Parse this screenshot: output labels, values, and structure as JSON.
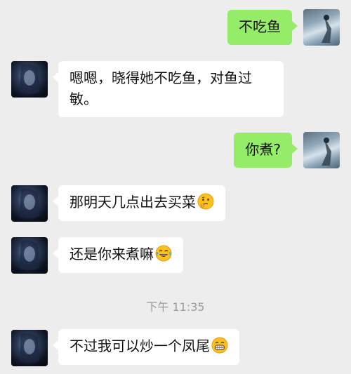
{
  "colors": {
    "background": "#ededed",
    "self_bubble": "#95ec69",
    "other_bubble": "#ffffff",
    "timestamp_text": "#9c9c9c"
  },
  "messages": [
    {
      "sender": "self",
      "text": "不吃鱼"
    },
    {
      "sender": "other",
      "text": "嗯嗯，晓得她不吃鱼，对鱼过敏。"
    },
    {
      "sender": "self",
      "text": "你煮?"
    },
    {
      "sender": "other",
      "text": "那明天几点出去买菜",
      "emoji": "thinking-face-icon"
    },
    {
      "sender": "other",
      "text": "还是你来煮嘛",
      "emoji": "tears-of-joy-icon"
    },
    {
      "sender": "other",
      "text": "不过我可以炒一个凤尾",
      "emoji": "grinning-face-icon"
    }
  ],
  "timestamp": "下午 11:35"
}
